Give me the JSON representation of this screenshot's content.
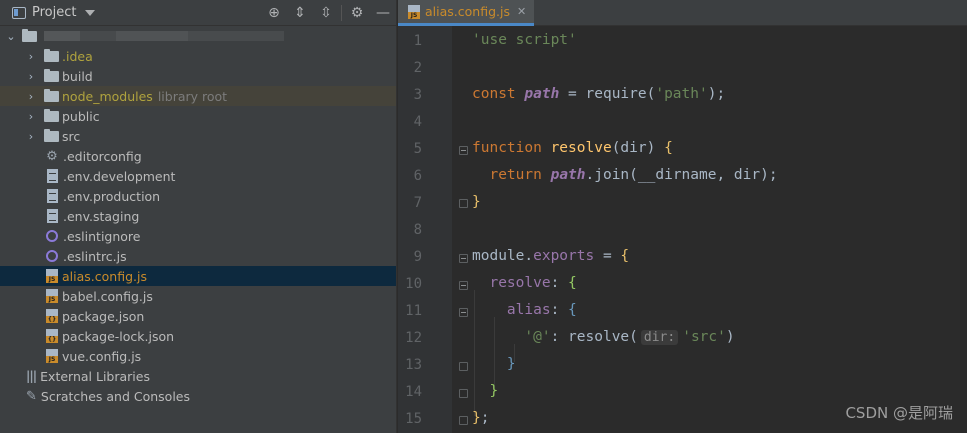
{
  "project_panel": {
    "title": "Project",
    "tree": [
      {
        "label": ".idea",
        "hint": ""
      },
      {
        "label": "build",
        "hint": ""
      },
      {
        "label": "node_modules",
        "hint": "library root"
      },
      {
        "label": "public",
        "hint": ""
      },
      {
        "label": "src",
        "hint": ""
      },
      {
        "label": ".editorconfig",
        "hint": ""
      },
      {
        "label": ".env.development",
        "hint": ""
      },
      {
        "label": ".env.production",
        "hint": ""
      },
      {
        "label": ".env.staging",
        "hint": ""
      },
      {
        "label": ".eslintignore",
        "hint": ""
      },
      {
        "label": ".eslintrc.js",
        "hint": ""
      },
      {
        "label": "alias.config.js",
        "hint": ""
      },
      {
        "label": "babel.config.js",
        "hint": ""
      },
      {
        "label": "package.json",
        "hint": ""
      },
      {
        "label": "package-lock.json",
        "hint": ""
      },
      {
        "label": "vue.config.js",
        "hint": ""
      },
      {
        "label": "External Libraries",
        "hint": ""
      },
      {
        "label": "Scratches and Consoles",
        "hint": ""
      }
    ]
  },
  "editor": {
    "tab_label": "alias.config.js",
    "line_numbers": [
      "1",
      "2",
      "3",
      "4",
      "5",
      "6",
      "7",
      "8",
      "9",
      "10",
      "11",
      "12",
      "13",
      "14",
      "15"
    ],
    "inlay_hint": "dir:"
  },
  "code": {
    "l1_str": "'use script'",
    "l3_kw": "const",
    "l3_var": "path",
    "l3_mid": " = require(",
    "l3_str": "'path'",
    "l3_end": ");",
    "l5_kw": "function",
    "l5_fn": "resolve",
    "l5_args": "(dir) ",
    "l5_brace": "{",
    "l6_kw": "return",
    "l6_var": "path",
    "l6_rest": ".join(__dirname, dir);",
    "l7_brace": "}",
    "l9_module": "module.",
    "l9_exports": "exports",
    "l9_eq": " = ",
    "l9_brace": "{",
    "l10_prop": "resolve",
    "l10_colon": ": ",
    "l10_brace": "{",
    "l11_prop": "alias",
    "l11_colon": ": ",
    "l11_brace": "{",
    "l12_key": "'@'",
    "l12_mid": ": resolve(",
    "l12_str": "'src'",
    "l12_end": ")",
    "l13_brace": "}",
    "l14_brace": "}",
    "l15_brace": "}",
    "l15_end": ";"
  },
  "watermark": "CSDN @是阿瑞"
}
